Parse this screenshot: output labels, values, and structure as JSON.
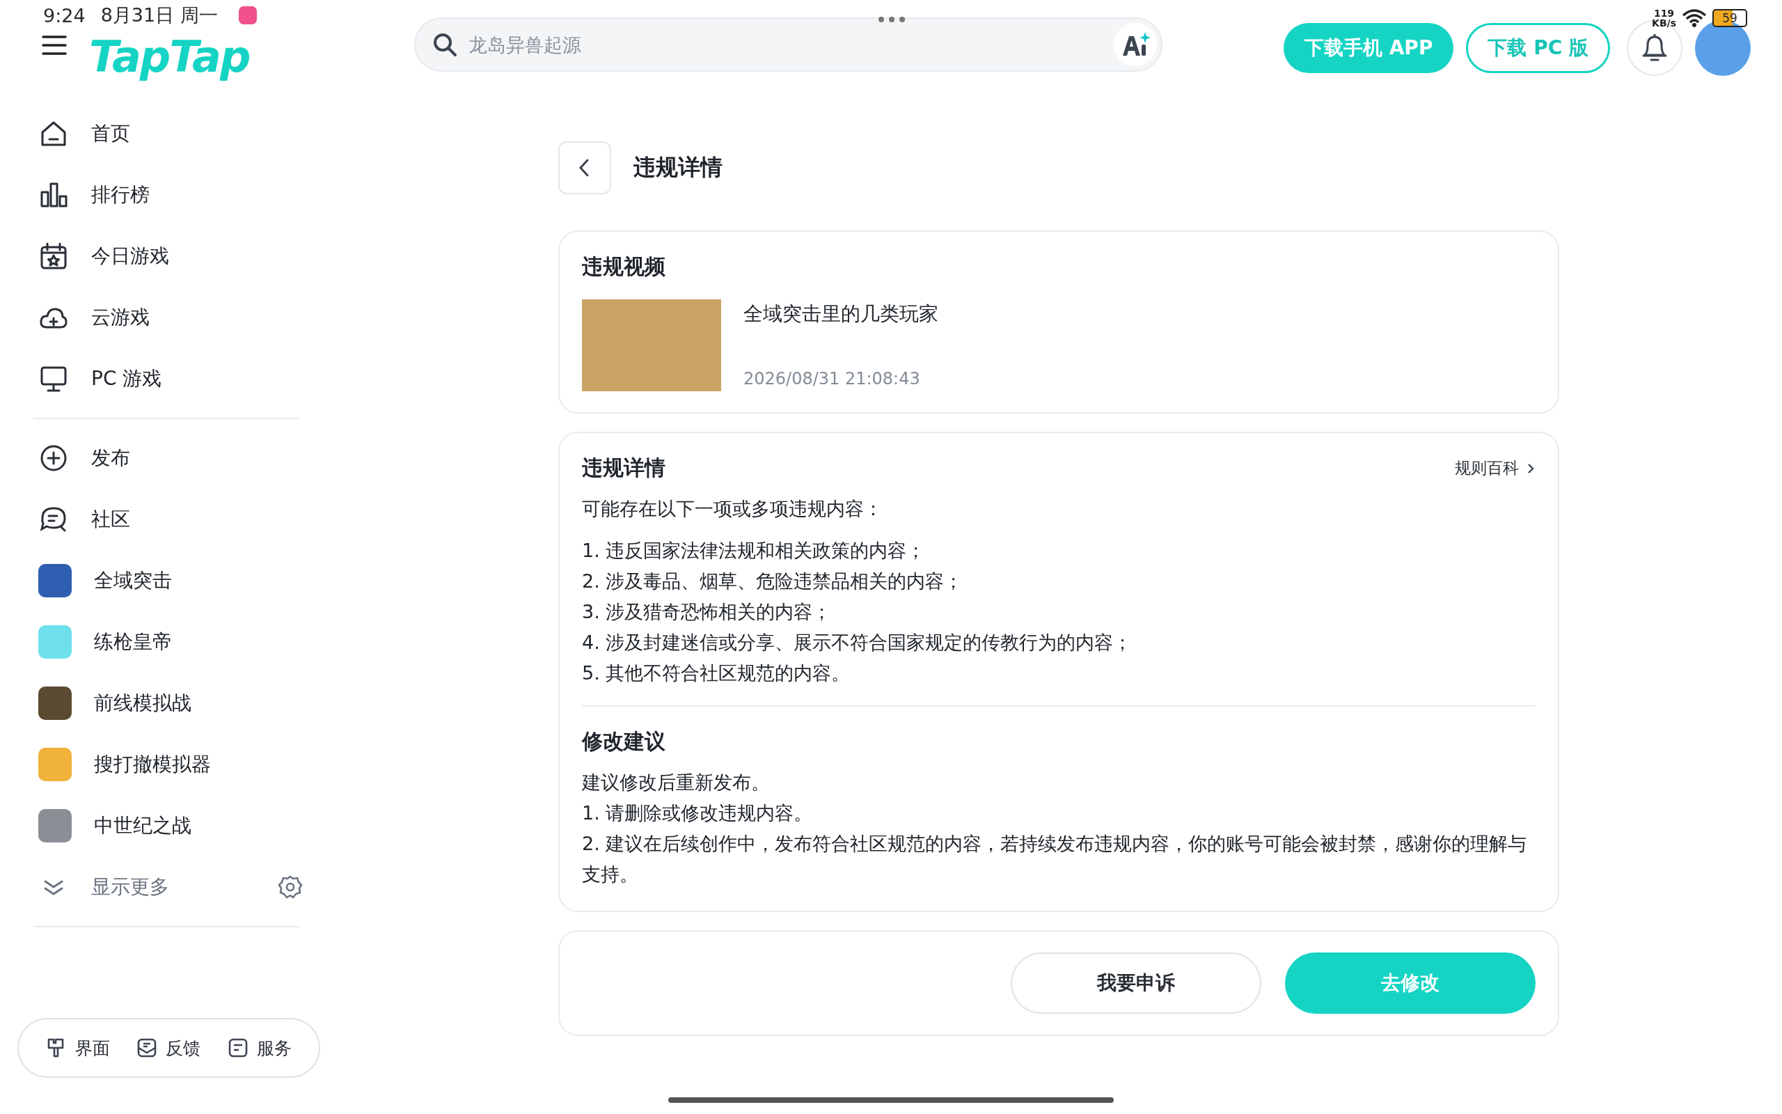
{
  "status_bar": {
    "time": "9:24",
    "date": "8月31日 周一",
    "net_speed": "119",
    "net_unit": "KB/s",
    "battery": "59"
  },
  "header": {
    "logo": "TapTap",
    "search": {
      "placeholder": "龙岛异兽起源"
    },
    "buttons": [
      "下载手机 APP",
      "下载 PC 版"
    ]
  },
  "sidebar": {
    "nav": [
      {
        "label": "首页"
      },
      {
        "label": "排行榜"
      },
      {
        "label": "今日游戏"
      },
      {
        "label": "云游戏"
      },
      {
        "label": "PC 游戏"
      }
    ],
    "actions": [
      {
        "label": "发布"
      },
      {
        "label": "社区"
      }
    ],
    "games": [
      {
        "label": "全域突击",
        "color": "#2f5fb0"
      },
      {
        "label": "练枪皇帝",
        "color": "#6ee0ec"
      },
      {
        "label": "前线模拟战",
        "color": "#5b4a32"
      },
      {
        "label": "搜打撤模拟器",
        "color": "#f0b23a"
      },
      {
        "label": "中世纪之战",
        "color": "#8a8f96"
      }
    ],
    "show_more": "显示更多",
    "footer": [
      {
        "label": "界面"
      },
      {
        "label": "反馈"
      },
      {
        "label": "服务"
      }
    ]
  },
  "page": {
    "title": "违规详情",
    "video_card": {
      "heading": "违规视频",
      "video_title": "全域突击里的几类玩家",
      "time": "2026/08/31 21:08:43"
    },
    "detail_card": {
      "heading": "违规详情",
      "rules_link": "规则百科",
      "intro": "可能存在以下一项或多项违规内容：",
      "items": [
        "1. 违反国家法律法规和相关政策的内容；",
        "2. 涉及毒品、烟草、危险违禁品相关的内容；",
        "3. 涉及猎奇恐怖相关的内容；",
        "4. 涉及封建迷信或分享、展示不符合国家规定的传教行为的内容；",
        "5. 其他不符合社区规范的内容。"
      ],
      "advice_heading": "修改建议",
      "advice": [
        "建议修改后重新发布。",
        "1. 请删除或修改违规内容。",
        "2. 建议在后续创作中，发布符合社区规范的内容，若持续发布违规内容，你的账号可能会被封禁，感谢你的理解与支持。"
      ]
    },
    "actions": {
      "appeal": "我要申诉",
      "edit": "去修改"
    }
  }
}
